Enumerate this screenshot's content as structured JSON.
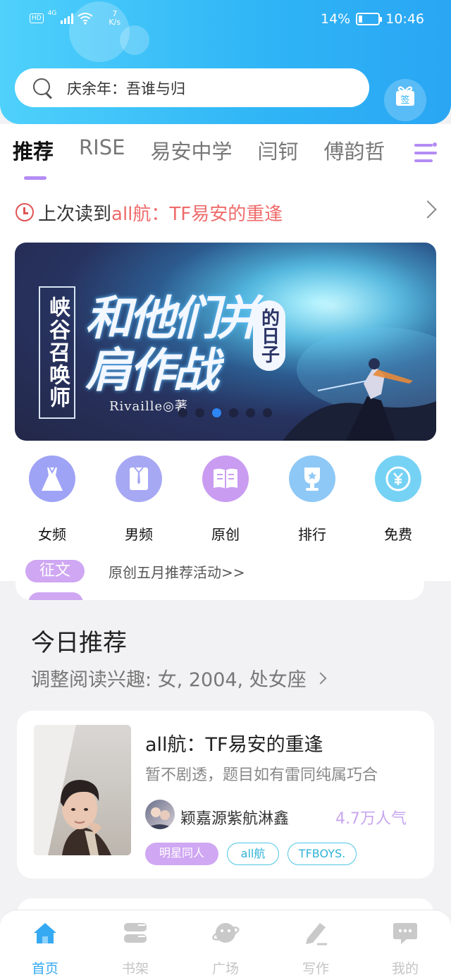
{
  "status_bar": {
    "hd": "HD",
    "network": "4G",
    "speed_value": "7",
    "speed_unit": "K/s",
    "battery": "14%",
    "time": "10:46"
  },
  "search": {
    "placeholder_text": "庆余年：吾谁与归"
  },
  "sign_in": {
    "label": "签"
  },
  "tabs": [
    {
      "label": "推荐",
      "active": true
    },
    {
      "label": "RISE"
    },
    {
      "label": "易安中学"
    },
    {
      "label": "闫钶"
    },
    {
      "label": "傅韵哲"
    }
  ],
  "last_read": {
    "prefix": "上次读到",
    "title": "all航：TF易安的重逢"
  },
  "banner": {
    "vertical_title": "峡谷召唤师",
    "main_title": "和他们并肩作战",
    "sub_title": "的日子",
    "author": "Rivaille◎著",
    "dot_count": 6,
    "active_dot": 2
  },
  "categories": [
    {
      "label": "女频",
      "icon": "dress-icon",
      "color": "#9ea3f6"
    },
    {
      "label": "男频",
      "icon": "shirt-icon",
      "color": "#a7a8f4"
    },
    {
      "label": "原创",
      "icon": "book-icon",
      "color": "#c99cf1"
    },
    {
      "label": "排行",
      "icon": "trophy-icon",
      "color": "#8ec8f6"
    },
    {
      "label": "免费",
      "icon": "coin-icon",
      "color": "#76d2f4"
    }
  ],
  "notice": {
    "tag": "征文",
    "text": "原创五月推荐活动>>"
  },
  "today": {
    "title": "今日推荐",
    "interest": "调整阅读兴趣: 女, 2004, 处女座"
  },
  "book": {
    "title": "all航：TF易安的重逢",
    "description": "暂不剧透，题目如有雷同纯属巧合",
    "author": "颖嘉源紫航淋鑫",
    "popularity": "4.7万人气",
    "tags": [
      "明星同人",
      "all航",
      "TFBOYS."
    ]
  },
  "bottom_nav": [
    {
      "label": "首页",
      "icon": "home-icon",
      "active": true
    },
    {
      "label": "书架",
      "icon": "bookshelf-icon"
    },
    {
      "label": "广场",
      "icon": "planet-icon"
    },
    {
      "label": "写作",
      "icon": "pen-icon"
    },
    {
      "label": "我的",
      "icon": "chat-bubble-icon"
    }
  ],
  "colors": {
    "header_gradient_start": "#4fd1fb",
    "header_gradient_end": "#2aa6f3",
    "accent_purple": "#b48cf4",
    "accent_red": "#ef6b6b",
    "accent_blue": "#35a9f2"
  }
}
